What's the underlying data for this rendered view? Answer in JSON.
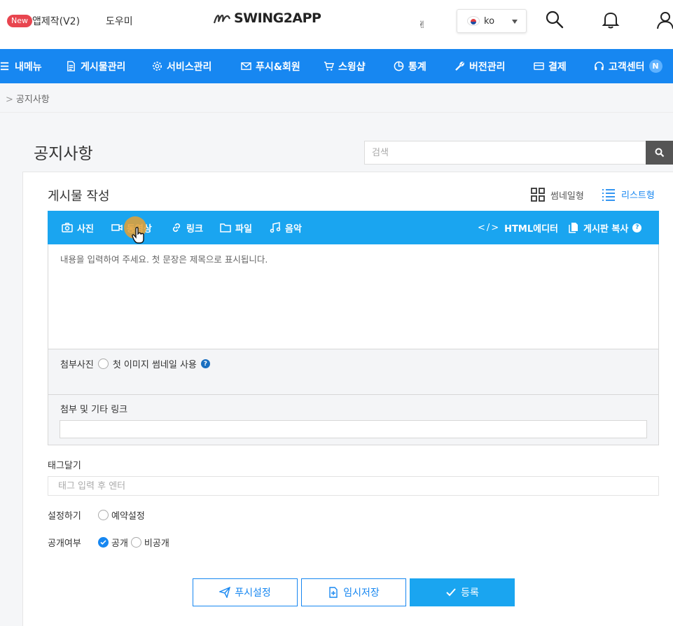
{
  "header": {
    "new_badge": "New",
    "app_make": "앱제작(V2)",
    "help": "도우미",
    "logo_text": "SWING2APP",
    "language_code": "ko"
  },
  "nav": [
    {
      "label": "내메뉴",
      "icon": "menu-icon"
    },
    {
      "label": "게시물관리",
      "icon": "document-icon"
    },
    {
      "label": "서비스관리",
      "icon": "gear-icon"
    },
    {
      "label": "푸시&회원",
      "icon": "mail-icon"
    },
    {
      "label": "스윙샵",
      "icon": "cart-icon"
    },
    {
      "label": "통계",
      "icon": "pie-chart-icon"
    },
    {
      "label": "버전관리",
      "icon": "wrench-icon"
    },
    {
      "label": "결제",
      "icon": "card-icon"
    },
    {
      "label": "고객센터",
      "icon": "headset-icon",
      "badge": "N"
    }
  ],
  "breadcrumb": {
    "separator": ">",
    "current": "공지사항"
  },
  "page": {
    "title": "공지사항",
    "search_placeholder": "검색"
  },
  "post": {
    "title": "게시물 작성",
    "thumb_view": "썸네일형",
    "list_view": "리스트형"
  },
  "toolbar": {
    "photo": "사진",
    "video": "동영상",
    "link": "링크",
    "file": "파일",
    "music": "음악",
    "html_editor": "HTML에디터",
    "copy_board": "게시판 복사"
  },
  "editor": {
    "placeholder": "내용을 입력하여 주세요. 첫 문장은 제목으로 표시됩니다."
  },
  "attach": {
    "photo_label": "첨부사진",
    "first_image_option": "첫 이미지 썸네일 사용",
    "link_label": "첨부 및 기타 링크"
  },
  "tags": {
    "label": "태그달기",
    "placeholder": "태그 입력 후 엔터"
  },
  "settings": {
    "label": "설정하기",
    "reserve": "예약설정",
    "visibility_label": "공개여부",
    "public": "공개",
    "private": "비공개"
  },
  "buttons": {
    "push": "푸시설정",
    "draft": "임시저장",
    "submit": "등록"
  },
  "colors": {
    "nav_blue": "#1787f1",
    "toolbar_blue": "#1aa5f0",
    "new_red": "#e8454f"
  }
}
